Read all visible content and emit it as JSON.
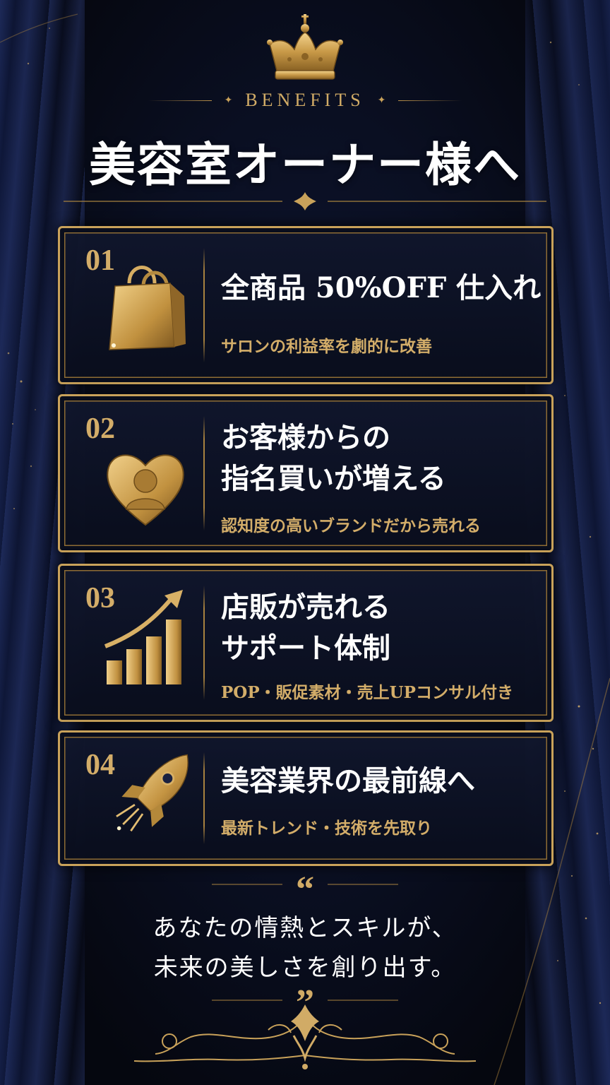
{
  "header": {
    "eyebrow": "BENEFITS",
    "title": "美容室オーナー様へ"
  },
  "benefits": [
    {
      "number": "01",
      "headline": "全商品 50%OFF 仕入れ",
      "sub": "サロンの利益率を劇的に改善",
      "icon": "shopping-bag-icon"
    },
    {
      "number": "02",
      "headline": "お客様からの\n指名買いが増える",
      "sub": "認知度の高いブランドだから売れる",
      "icon": "heart-person-icon"
    },
    {
      "number": "03",
      "headline": "店販が売れる\nサポート体制",
      "sub": "POP・販促素材・売上UPコンサル付き",
      "icon": "growth-chart-icon"
    },
    {
      "number": "04",
      "headline": "美容業界の最前線へ",
      "sub": "最新トレンド・技術を先取り",
      "icon": "rocket-icon"
    }
  ],
  "quote": {
    "open_mark": "“",
    "close_mark": "”",
    "line1": "あなたの情熱とスキルが、",
    "line2": "未来の美しさを創り出す。"
  },
  "colors": {
    "background": "#070b18",
    "gold": "#d1ab66",
    "text": "#ffffff"
  }
}
